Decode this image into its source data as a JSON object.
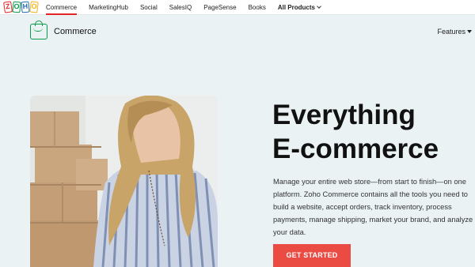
{
  "topnav": {
    "logo_letters": [
      "Z",
      "O",
      "H",
      "O"
    ],
    "links": [
      {
        "label": "Commerce"
      },
      {
        "label": "MarketingHub"
      },
      {
        "label": "Social"
      },
      {
        "label": "SalesIQ"
      },
      {
        "label": "PageSense"
      },
      {
        "label": "Books"
      },
      {
        "label": "All Products"
      }
    ]
  },
  "subheader": {
    "brand": "Commerce",
    "brand_icon": "shopping-bag-icon",
    "features_label": "Features"
  },
  "hero": {
    "headline_line1": "Everything",
    "headline_line2": "E-commerce",
    "description": "Manage your entire web store—from start to finish—on one platform. Zoho Commerce contains all the tools you need to build a website, accept orders, track inventory, process payments, manage shipping, market your brand, and analyze your data.",
    "cta_label": "GET STARTED"
  },
  "colors": {
    "page_bg": "#eaf2f3",
    "cta_bg": "#ea4c44",
    "brand_green": "#089949",
    "logo_red": "#e42527",
    "logo_green": "#089949",
    "logo_blue": "#226db4",
    "logo_yellow": "#f9b21d"
  }
}
